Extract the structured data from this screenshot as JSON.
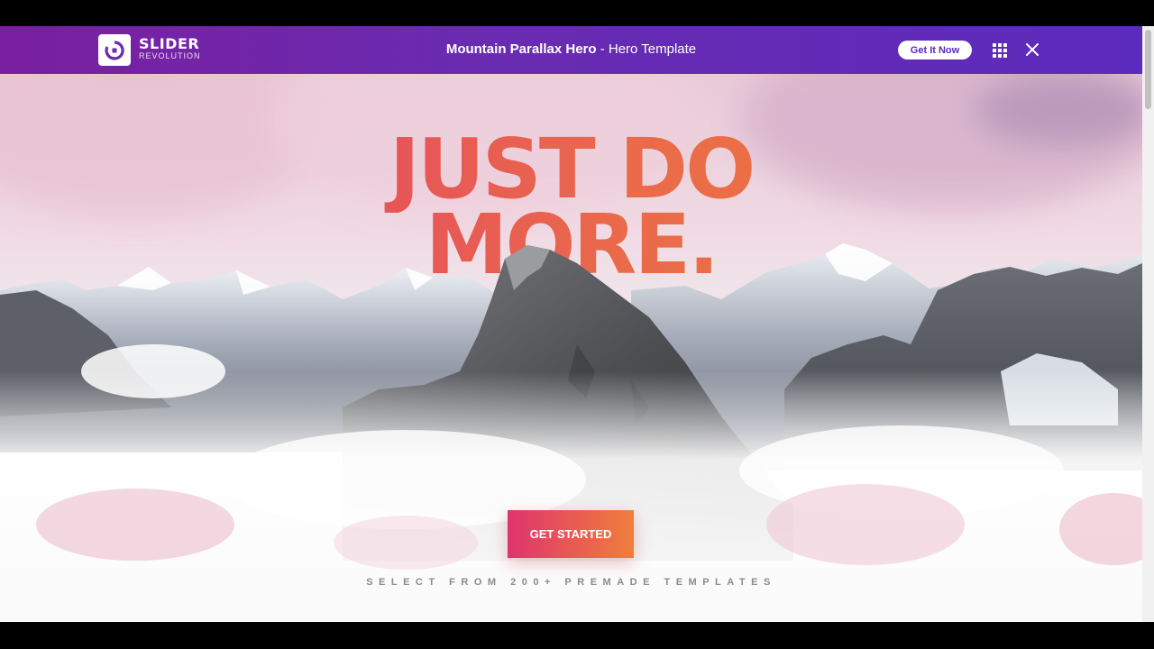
{
  "header": {
    "logo_title": "SLIDER",
    "logo_subtitle": "REVOLUTION",
    "title_bold": "Mountain Parallax Hero",
    "title_rest": " - Hero Template",
    "get_it_label": "Get It Now",
    "grid_icon": "grid-icon",
    "close_icon": "close-icon"
  },
  "hero": {
    "headline_line1": "JUST DO",
    "headline_line2": "MORE.",
    "cta_label": "GET STARTED",
    "tagline": "SELECT FROM 200+ PREMADE TEMPLATES"
  },
  "colors": {
    "header_start": "#7a1fa0",
    "header_end": "#5b2bbd",
    "gradient_pink": "#e0336f",
    "gradient_orange": "#ef7f3a"
  }
}
